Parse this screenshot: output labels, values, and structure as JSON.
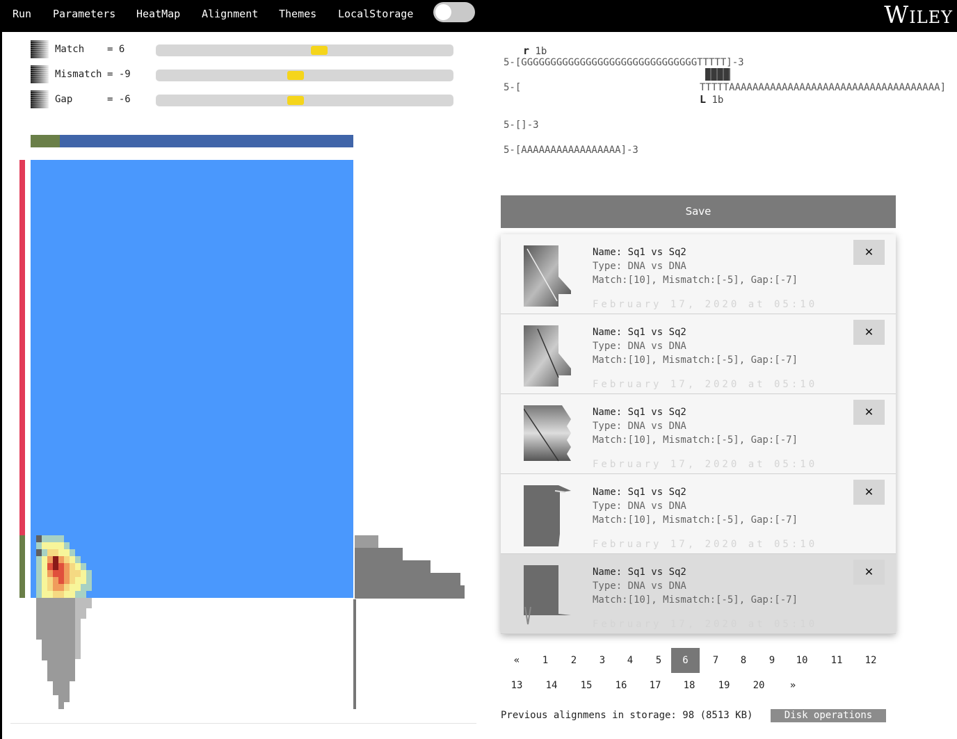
{
  "nav": {
    "items": [
      "Run",
      "Parameters",
      "HeatMap",
      "Alignment",
      "Themes",
      "LocalStorage"
    ],
    "toggle_on": false,
    "brand": "Wiley"
  },
  "params": [
    {
      "label": "Match",
      "value": "= 6",
      "level": 0.55
    },
    {
      "label": "Mismatch",
      "value": "= -9",
      "level": 0.47
    },
    {
      "label": "Gap",
      "value": "= -6",
      "level": 0.47
    }
  ],
  "ratio_bar": {
    "green_fraction": 0.09,
    "green": "#6a7f48",
    "blue": "#4065a9"
  },
  "heatmap": {
    "fill": "#4a98fd",
    "accent_red": "#e23b57",
    "accent_green": "#6a7f48"
  },
  "alignment": {
    "mark_top": "1b",
    "line1": "5-[GGGGGGGGGGGGGGGGGGGGGGGGGGGGGGTTTTT]-3",
    "line2_prefix": "5-[",
    "line2_seq": "TTTTTAAAAAAAAAAAAAAAAAAAAAAAAAAAAAAAAAAAA]",
    "mark_bottom": "1b",
    "line3": "5-[]-3",
    "line4": "5-[AAAAAAAAAAAAAAAAA]-3"
  },
  "save_label": "Save",
  "saved": [
    {
      "name": "Name: Sq1 vs Sq2",
      "type": "Type: DNA vs DNA",
      "params": "Match:[10], Mismatch:[-5], Gap:[-7]",
      "date": "February 17, 2020 at 05:10",
      "delete": "✕"
    },
    {
      "name": "Name: Sq1 vs Sq2",
      "type": "Type: DNA vs DNA",
      "params": "Match:[10], Mismatch:[-5], Gap:[-7]",
      "date": "February 17, 2020 at 05:10",
      "delete": "✕"
    },
    {
      "name": "Name: Sq1 vs Sq2",
      "type": "Type: DNA vs DNA",
      "params": "Match:[10], Mismatch:[-5], Gap:[-7]",
      "date": "February 17, 2020 at 05:10",
      "delete": "✕"
    },
    {
      "name": "Name: Sq1 vs Sq2",
      "type": "Type: DNA vs DNA",
      "params": "Match:[10], Mismatch:[-5], Gap:[-7]",
      "date": "February 17, 2020 at 05:10",
      "delete": "✕"
    },
    {
      "name": "Name: Sq1 vs Sq2",
      "type": "Type: DNA vs DNA",
      "params": "Match:[10], Mismatch:[-5], Gap:[-7]",
      "date": "February 17, 2020 at 05:10",
      "delete": "✕"
    }
  ],
  "pagination": {
    "prev": "«",
    "next": "»",
    "pages": [
      "1",
      "2",
      "3",
      "4",
      "5",
      "6",
      "7",
      "8",
      "9",
      "10",
      "11",
      "12",
      "13",
      "14",
      "15",
      "16",
      "17",
      "18",
      "19",
      "20"
    ],
    "current": "6"
  },
  "storage": {
    "text": "Previous alignmens in storage: 98 (8513 KB)",
    "disk_button": "Disk operations"
  }
}
